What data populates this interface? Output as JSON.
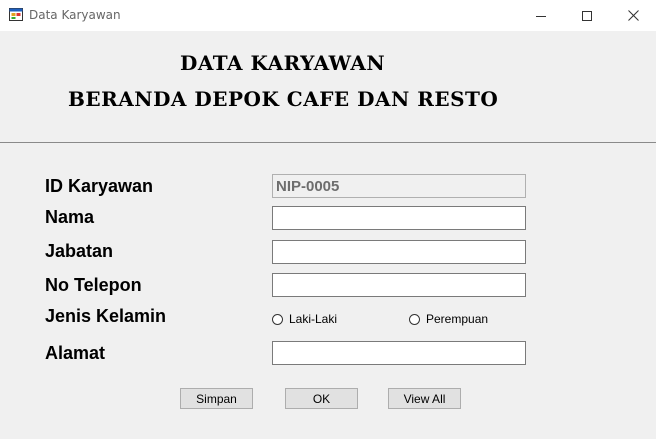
{
  "window": {
    "title": "Data Karyawan",
    "controls": {
      "minimize": "minimize-icon",
      "maximize": "maximize-icon",
      "close": "close-icon"
    }
  },
  "header": {
    "line1": "DATA KARYAWAN",
    "line2": "BERANDA DEPOK CAFE DAN RESTO"
  },
  "form": {
    "id_label": "ID Karyawan",
    "id_value": "NIP-0005",
    "nama_label": "Nama",
    "nama_value": "",
    "jabatan_label": "Jabatan",
    "jabatan_value": "",
    "telepon_label": "No Telepon",
    "telepon_value": "",
    "gender_label": "Jenis Kelamin",
    "gender_options": [
      "Laki-Laki",
      "Perempuan"
    ],
    "alamat_label": "Alamat",
    "alamat_value": ""
  },
  "buttons": {
    "simpan": "Simpan",
    "ok": "OK",
    "view_all": "View All"
  },
  "colors": {
    "window_bg": "#f0f0f0",
    "titlebar_bg": "#ffffff",
    "readonly_text": "#6d6d6d"
  }
}
